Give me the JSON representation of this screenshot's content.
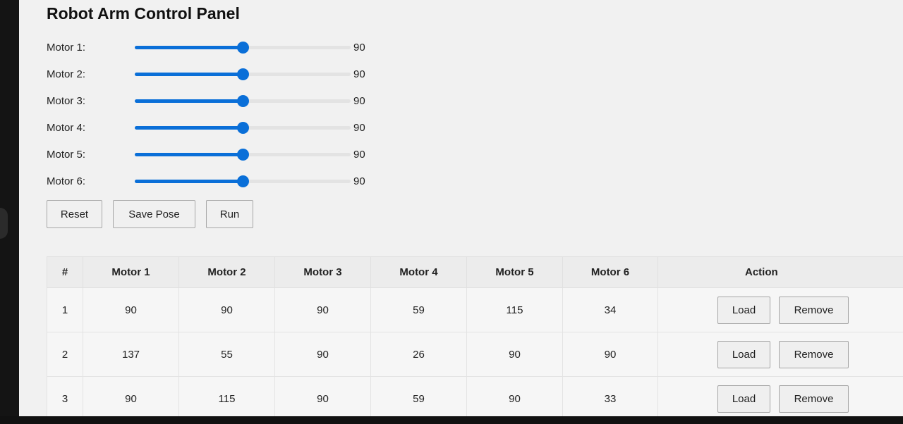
{
  "title": "Robot Arm Control Panel",
  "slider_range": {
    "min": 0,
    "max": 180
  },
  "motors": [
    {
      "label": "Motor 1:",
      "value": "90"
    },
    {
      "label": "Motor 2:",
      "value": "90"
    },
    {
      "label": "Motor 3:",
      "value": "90"
    },
    {
      "label": "Motor 4:",
      "value": "90"
    },
    {
      "label": "Motor 5:",
      "value": "90"
    },
    {
      "label": "Motor 6:",
      "value": "90"
    }
  ],
  "buttons": {
    "reset": "Reset",
    "save_pose": "Save Pose",
    "run": "Run"
  },
  "table": {
    "headers": [
      "#",
      "Motor 1",
      "Motor 2",
      "Motor 3",
      "Motor 4",
      "Motor 5",
      "Motor 6",
      "Action"
    ],
    "rows": [
      [
        "1",
        "90",
        "90",
        "90",
        "59",
        "115",
        "34"
      ],
      [
        "2",
        "137",
        "55",
        "90",
        "26",
        "90",
        "90"
      ],
      [
        "3",
        "90",
        "115",
        "90",
        "59",
        "90",
        "33"
      ]
    ],
    "load_label": "Load",
    "remove_label": "Remove"
  },
  "colors": {
    "accent": "#0a6fd8",
    "background": "#f1f1f1"
  }
}
